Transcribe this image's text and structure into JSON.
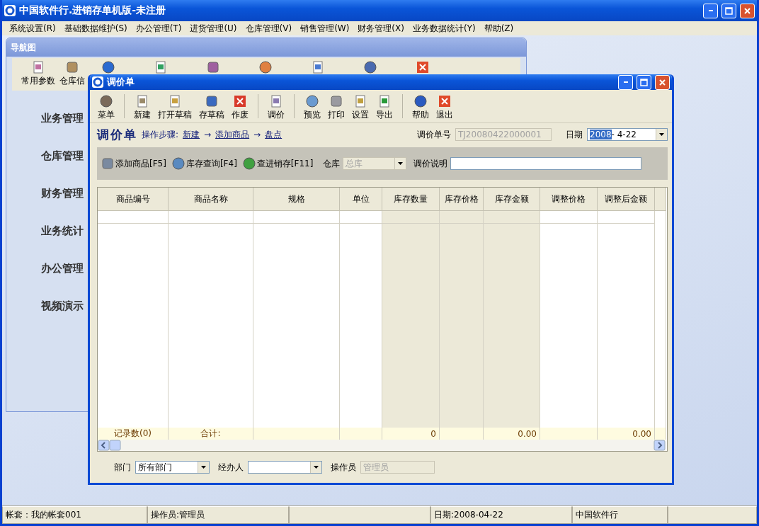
{
  "window": {
    "title": "中国软件行.进销存单机版-未注册"
  },
  "menu": [
    "系统设置(R)",
    "基础数据维护(S)",
    "办公管理(T)",
    "进货管理(U)",
    "仓库管理(V)",
    "销售管理(W)",
    "财务管理(X)",
    "业务数据统计(Y)",
    "帮助(Z)"
  ],
  "navigator": {
    "title": "导航图",
    "tools": [
      "常用参数",
      "仓库信"
    ],
    "items": [
      "业务管理",
      "仓库管理",
      "财务管理",
      "业务统计",
      "办公管理",
      "视频演示"
    ]
  },
  "document": {
    "title": "调价单",
    "toolbar": [
      "菜单",
      "新建",
      "打开草稿",
      "存草稿",
      "作废",
      "调价",
      "预览",
      "打印",
      "设置",
      "导出",
      "帮助",
      "退出"
    ],
    "heading": "调价单",
    "steps_label": "操作步骤:",
    "steps": [
      "新建",
      "添加商品",
      "盘点"
    ],
    "step_arrow": "→",
    "number": {
      "label": "调价单号",
      "value": "TJ20080422000001",
      "disabled": true
    },
    "date": {
      "label": "日期",
      "selection": "2008",
      "value": "- 4-22"
    },
    "actions": [
      "添加商品[F5]",
      "库存查询[F4]",
      "查进销存[F11]"
    ],
    "warehouse": {
      "label": "仓库",
      "value": "总库",
      "disabled": true
    },
    "note": {
      "label": "调价说明"
    },
    "table": {
      "columns": [
        {
          "label": "商品编号",
          "readonly": false,
          "total": "记录数(0)"
        },
        {
          "label": "商品名称",
          "readonly": false,
          "total": "合计:"
        },
        {
          "label": "规格",
          "readonly": false
        },
        {
          "label": "单位",
          "readonly": false
        },
        {
          "label": "库存数量",
          "readonly": true,
          "total": "0"
        },
        {
          "label": "库存价格",
          "readonly": true
        },
        {
          "label": "库存金额",
          "readonly": true,
          "total": "0.00"
        },
        {
          "label": "调整价格",
          "readonly": false
        },
        {
          "label": "调整后金额",
          "readonly": false,
          "total": "0.00"
        }
      ]
    },
    "fields": [
      {
        "kind": "combo",
        "label": "部门",
        "value": "所有部门"
      },
      {
        "kind": "combo",
        "label": "经办人"
      },
      {
        "kind": "text",
        "label": "操作员",
        "value": "管理员",
        "disabled": true
      }
    ]
  },
  "status_bar": [
    {
      "kind": "text",
      "text": "帐套：我的帐套001"
    },
    {
      "kind": "text",
      "text": "操作员:管理员"
    },
    {
      "kind": "blank"
    },
    {
      "kind": "text",
      "text": "日期:2008-04-22"
    },
    {
      "kind": "text",
      "text": "中国软件行"
    }
  ]
}
